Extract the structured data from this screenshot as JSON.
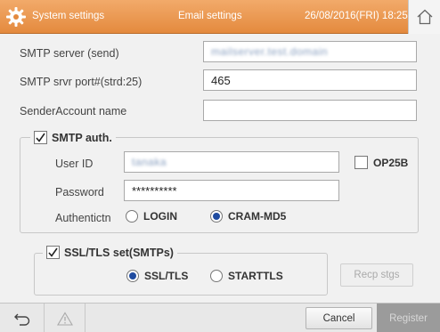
{
  "titlebar": {
    "system_label": "System settings",
    "email_label": "Email settings",
    "datetime": "26/08/2016(FRI) 18:25"
  },
  "form": {
    "smtp_server_label": "SMTP server (send)",
    "smtp_server_value": "mailserver.test.domain",
    "smtp_port_label": "SMTP srvr port#(strd:25)",
    "smtp_port_value": "465",
    "sender_account_label": "SenderAccount name",
    "sender_account_value": ""
  },
  "smtp_auth": {
    "label": "SMTP auth.",
    "checked": true,
    "user_id_label": "User ID",
    "user_id_value": "tanaka",
    "op25b_label": "OP25B",
    "password_label": "Password",
    "password_value": "**********",
    "auth_label": "Authentictn",
    "options": [
      "LOGIN",
      "CRAM-MD5"
    ],
    "selected": "CRAM-MD5"
  },
  "ssl": {
    "label": "SSL/TLS set(SMTPs)",
    "checked": true,
    "options": [
      "SSL/TLS",
      "STARTTLS"
    ],
    "selected": "SSL/TLS",
    "recp_label": "Recp stgs"
  },
  "bottom": {
    "cancel_label": "Cancel",
    "register_label": "Register"
  },
  "colors": {
    "titlebar": "#e89046",
    "radio_selected": "#1f4ba0"
  }
}
